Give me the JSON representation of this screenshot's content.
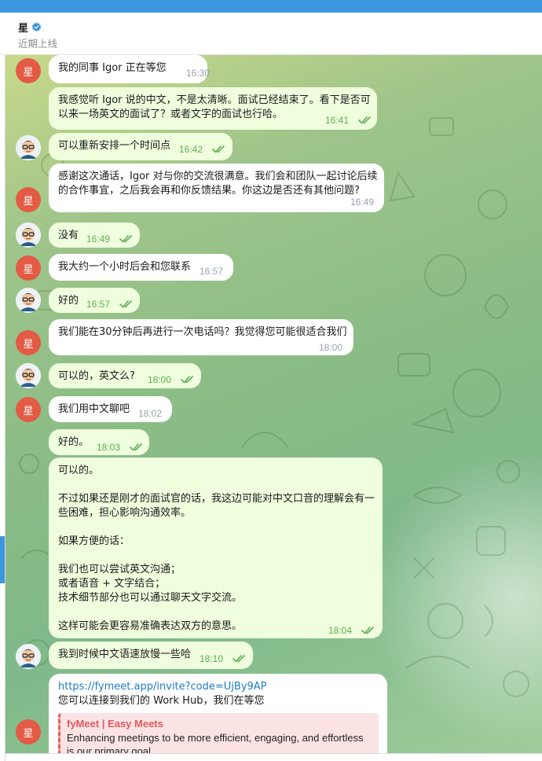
{
  "header": {
    "title": "星",
    "status": "近期上线"
  },
  "contact_avatar_letter": "星",
  "colors": {
    "accent": "#3d97e0",
    "incoming_bubble": "#ffffff",
    "outgoing_bubble": "#effedd",
    "avatar_bg": "#e35b45",
    "read_ticks": "#5fad55",
    "link_preview_title": "#e0595d"
  },
  "icons": [
    "verified-badge-icon",
    "double-check-icon"
  ],
  "messages": [
    {
      "dir": "in",
      "avatar": true,
      "text": "我的同事 Igor 正在等您",
      "time": "16:30"
    },
    {
      "dir": "out",
      "avatar": false,
      "text": "我感觉听 Igor 说的中文，不是太清晰。面试已经结束了。看下是否可\n以来一场英文的面试了？或者文字的面试也行哈。",
      "time": "16:41"
    },
    {
      "dir": "out",
      "avatar": true,
      "text": "可以重新安排一个时间点",
      "time": "16:42"
    },
    {
      "dir": "in",
      "avatar": true,
      "text": "感谢这次通话，Igor 对与你的交流很满意。我们会和团队一起讨论后续\n的合作事宜，之后我会再和你反馈结果。你这边是否还有其他问题?",
      "time": "16:49"
    },
    {
      "dir": "out",
      "avatar": true,
      "text": "没有",
      "time": "16:49"
    },
    {
      "dir": "in",
      "avatar": true,
      "text": "我大约一个小时后会和您联系",
      "time": "16:57"
    },
    {
      "dir": "out",
      "avatar": true,
      "text": "好的",
      "time": "16:57"
    },
    {
      "dir": "in",
      "avatar": true,
      "text": "我们能在30分钟后再进行一次电话吗？我觉得您可能很适合我们",
      "time": "18:00"
    },
    {
      "dir": "out",
      "avatar": true,
      "text": "可以的，英文么?",
      "time": "18:00"
    },
    {
      "dir": "in",
      "avatar": true,
      "text": "我们用中文聊吧",
      "time": "18:02"
    },
    {
      "dir": "out",
      "avatar": false,
      "text": "好的。",
      "time": "18:03"
    },
    {
      "dir": "out",
      "avatar": false,
      "text": "可以的。\n\n不过如果还是刚才的面试官的话，我这边可能对中文口音的理解会有一\n些困难，担心影响沟通效率。\n\n如果方便的话：\n\n我们也可以尝试英文沟通；\n或者语音 + 文字结合；\n技术细节部分也可以通过聊天文字交流。\n\n这样可能会更容易准确表达双方的意思。",
      "time": "18:04"
    },
    {
      "dir": "out",
      "avatar": true,
      "text": "我到时候中文语速放慢一些哈",
      "time": "18:10"
    }
  ],
  "last_message": {
    "dir": "in",
    "link": "https://fymeet.app/invite?code=UjBy9AP",
    "text": "您可以连接到我们的 Work Hub，我们在等您",
    "preview": {
      "title": "fyMeet | Easy Meets",
      "description": "Enhancing meetings to be more efficient, engaging, and effortless is our primary goal."
    }
  }
}
